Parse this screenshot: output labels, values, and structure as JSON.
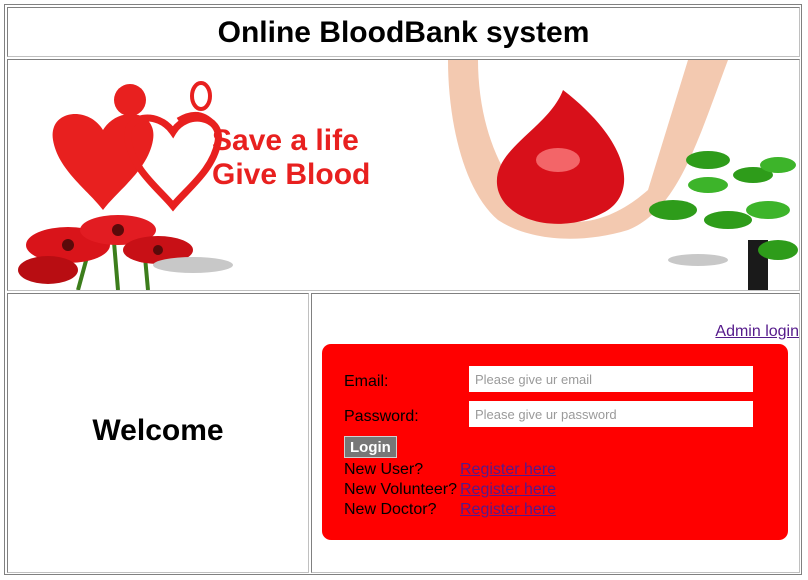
{
  "header": {
    "title": "Online BloodBank system"
  },
  "banner": {
    "slogan_line1": "Save a life",
    "slogan_line2": "Give Blood",
    "colors": {
      "red": "#e8201f",
      "drop": "#d8101a",
      "leaf": "#2e9c1a",
      "skin": "#f3c9b0"
    }
  },
  "welcome": {
    "text": "Welcome"
  },
  "login": {
    "admin_link": "Admin login",
    "email_label": "Email:",
    "email_placeholder": "Please give ur email",
    "password_label": "Password:",
    "password_placeholder": "Please give ur password",
    "login_button": "Login",
    "registrations": [
      {
        "question": "New User?",
        "link": "Register here"
      },
      {
        "question": "New Volunteer?",
        "link": "Register here"
      },
      {
        "question": "New Doctor?",
        "link": "Register here"
      }
    ],
    "panel_color": "#ff0000"
  }
}
